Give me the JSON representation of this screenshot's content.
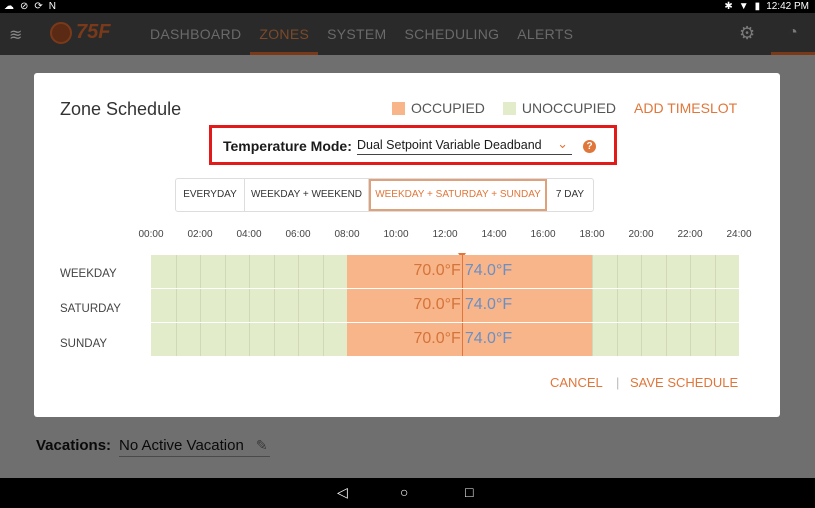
{
  "status_bar": {
    "time": "12:42 PM",
    "left_icons": [
      "cloud-icon",
      "block-icon",
      "sync-icon",
      "n-icon"
    ],
    "right_icons": [
      "bluetooth-icon",
      "wifi-icon",
      "battery-icon"
    ]
  },
  "nav": {
    "brand": "75F",
    "items": [
      {
        "label": "DASHBOARD",
        "active": false
      },
      {
        "label": "ZONES",
        "active": true
      },
      {
        "label": "SYSTEM",
        "active": false
      },
      {
        "label": "SCHEDULING",
        "active": false
      },
      {
        "label": "ALERTS",
        "active": false
      }
    ]
  },
  "vacations": {
    "label": "Vacations:",
    "value": "No Active Vacation"
  },
  "dialog": {
    "title": "Zone Schedule",
    "legend": {
      "occupied": "OCCUPIED",
      "unoccupied": "UNOCCUPIED"
    },
    "add_timeslot": "ADD TIMESLOT",
    "temperature_mode": {
      "label": "Temperature Mode:",
      "value": "Dual Setpoint Variable Deadband",
      "help": "?"
    },
    "tabs": [
      {
        "label": "EVERYDAY",
        "active": false
      },
      {
        "label": "WEEKDAY + WEEKEND",
        "active": false
      },
      {
        "label": "WEEKDAY + SATURDAY + SUNDAY",
        "active": true
      },
      {
        "label": "7 DAY",
        "active": false
      }
    ],
    "time_ticks": [
      "00:00",
      "02:00",
      "04:00",
      "06:00",
      "08:00",
      "10:00",
      "12:00",
      "14:00",
      "16:00",
      "18:00",
      "20:00",
      "22:00",
      "24:00"
    ],
    "rows": [
      {
        "label": "WEEKDAY",
        "occupied_start_hour": 8,
        "occupied_end_hour": 18,
        "heating": "70.0°F",
        "cooling": "74.0°F"
      },
      {
        "label": "SATURDAY",
        "occupied_start_hour": 8,
        "occupied_end_hour": 18,
        "heating": "70.0°F",
        "cooling": "74.0°F"
      },
      {
        "label": "SUNDAY",
        "occupied_start_hour": 8,
        "occupied_end_hour": 18,
        "heating": "70.0°F",
        "cooling": "74.0°F"
      }
    ],
    "current_time_hour": 12.7,
    "cancel": "CANCEL",
    "separator": "|",
    "save": "SAVE SCHEDULE"
  },
  "colors": {
    "accent": "#e0763a",
    "occupied": "#f9b58a",
    "unoccupied": "#e2ecca",
    "highlight_box": "#e31a1a",
    "cooling_text": "#6a8fc4"
  }
}
